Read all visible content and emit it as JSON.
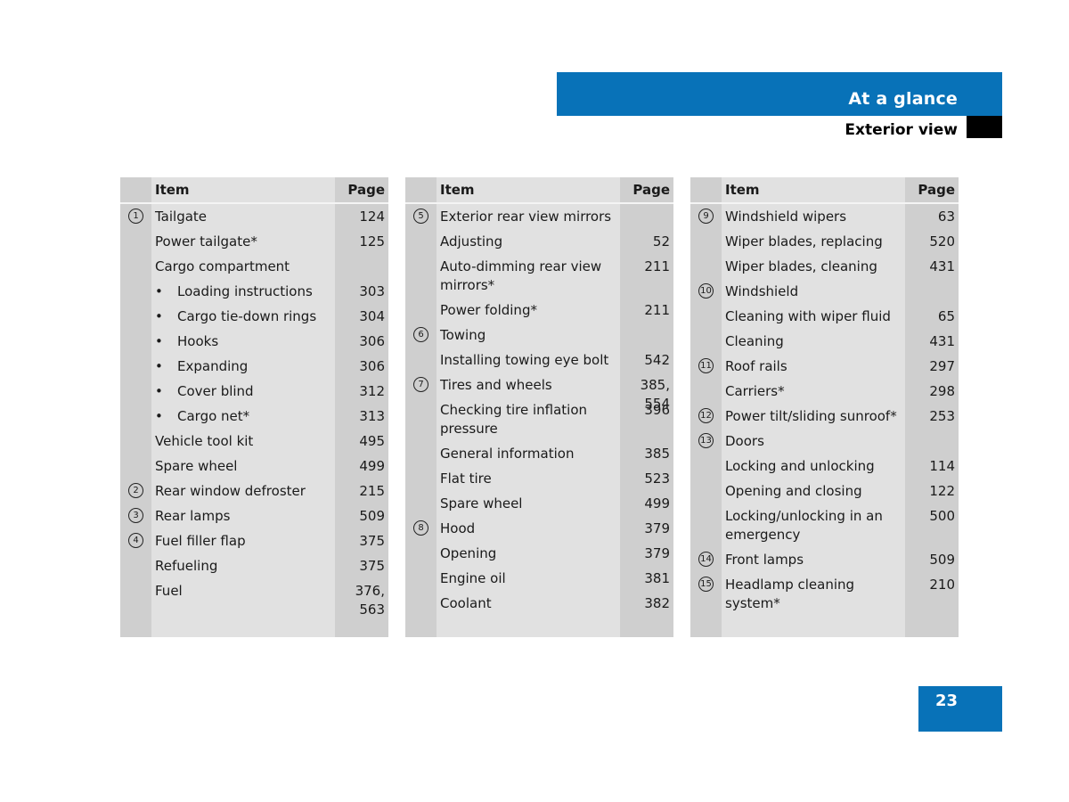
{
  "header": {
    "section_title": "At a glance",
    "subsection_title": "Exterior view",
    "accent_color": "#0872b8"
  },
  "page_number": "23",
  "tables": [
    {
      "header": {
        "item": "Item",
        "page": "Page"
      },
      "rows": [
        {
          "num": "1",
          "label": "Tailgate",
          "page": "124",
          "bullet": false
        },
        {
          "num": "",
          "label": "Power tailgate*",
          "page": "125",
          "bullet": false
        },
        {
          "num": "",
          "label": "Cargo compartment",
          "page": "",
          "bullet": false
        },
        {
          "num": "",
          "label": "Loading instructions",
          "page": "303",
          "bullet": true
        },
        {
          "num": "",
          "label": "Cargo tie-down rings",
          "page": "304",
          "bullet": true
        },
        {
          "num": "",
          "label": "Hooks",
          "page": "306",
          "bullet": true
        },
        {
          "num": "",
          "label": "Expanding",
          "page": "306",
          "bullet": true
        },
        {
          "num": "",
          "label": "Cover blind",
          "page": "312",
          "bullet": true
        },
        {
          "num": "",
          "label": "Cargo net*",
          "page": "313",
          "bullet": true
        },
        {
          "num": "",
          "label": "Vehicle tool kit",
          "page": "495",
          "bullet": false
        },
        {
          "num": "",
          "label": "Spare wheel",
          "page": "499",
          "bullet": false
        },
        {
          "num": "2",
          "label": "Rear window defroster",
          "page": "215",
          "bullet": false
        },
        {
          "num": "3",
          "label": "Rear lamps",
          "page": "509",
          "bullet": false
        },
        {
          "num": "4",
          "label": "Fuel filler flap",
          "page": "375",
          "bullet": false
        },
        {
          "num": "",
          "label": "Refueling",
          "page": "375",
          "bullet": false
        },
        {
          "num": "",
          "label": "Fuel",
          "page": "376, 563",
          "bullet": false
        }
      ]
    },
    {
      "header": {
        "item": "Item",
        "page": "Page"
      },
      "rows": [
        {
          "num": "5",
          "label": "Exterior rear view mirrors",
          "page": "",
          "bullet": false
        },
        {
          "num": "",
          "label": "Adjusting",
          "page": "52",
          "bullet": false
        },
        {
          "num": "",
          "label": "Auto-dimming rear view mirrors*",
          "page": "211",
          "bullet": false
        },
        {
          "num": "",
          "label": "Power folding*",
          "page": "211",
          "bullet": false
        },
        {
          "num": "6",
          "label": "Towing",
          "page": "",
          "bullet": false
        },
        {
          "num": "",
          "label": "Installing towing eye bolt",
          "page": "542",
          "bullet": false
        },
        {
          "num": "7",
          "label": "Tires and wheels",
          "page": "385, 554",
          "bullet": false
        },
        {
          "num": "",
          "label": "Checking tire inflation pressure",
          "page": "396",
          "bullet": false
        },
        {
          "num": "",
          "label": "General information",
          "page": "385",
          "bullet": false
        },
        {
          "num": "",
          "label": "Flat tire",
          "page": "523",
          "bullet": false
        },
        {
          "num": "",
          "label": "Spare wheel",
          "page": "499",
          "bullet": false
        },
        {
          "num": "8",
          "label": "Hood",
          "page": "379",
          "bullet": false
        },
        {
          "num": "",
          "label": "Opening",
          "page": "379",
          "bullet": false
        },
        {
          "num": "",
          "label": "Engine oil",
          "page": "381",
          "bullet": false
        },
        {
          "num": "",
          "label": "Coolant",
          "page": "382",
          "bullet": false
        }
      ]
    },
    {
      "header": {
        "item": "Item",
        "page": "Page"
      },
      "rows": [
        {
          "num": "9",
          "label": "Windshield wipers",
          "page": "63",
          "bullet": false
        },
        {
          "num": "",
          "label": "Wiper blades, replacing",
          "page": "520",
          "bullet": false
        },
        {
          "num": "",
          "label": "Wiper blades, cleaning",
          "page": "431",
          "bullet": false
        },
        {
          "num": "10",
          "label": "Windshield",
          "page": "",
          "bullet": false
        },
        {
          "num": "",
          "label": "Cleaning with wiper fluid",
          "page": "65",
          "bullet": false
        },
        {
          "num": "",
          "label": "Cleaning",
          "page": "431",
          "bullet": false
        },
        {
          "num": "11",
          "label": "Roof rails",
          "page": "297",
          "bullet": false
        },
        {
          "num": "",
          "label": "Carriers*",
          "page": "298",
          "bullet": false
        },
        {
          "num": "12",
          "label": "Power tilt/sliding sunroof*",
          "page": "253",
          "bullet": false
        },
        {
          "num": "13",
          "label": "Doors",
          "page": "",
          "bullet": false
        },
        {
          "num": "",
          "label": "Locking and unlocking",
          "page": "114",
          "bullet": false
        },
        {
          "num": "",
          "label": "Opening and closing",
          "page": "122",
          "bullet": false
        },
        {
          "num": "",
          "label": "Locking/unlocking in an emergency",
          "page": "500",
          "bullet": false
        },
        {
          "num": "14",
          "label": "Front lamps",
          "page": "509",
          "bullet": false
        },
        {
          "num": "15",
          "label": "Headlamp cleaning system*",
          "page": "210",
          "bullet": false
        }
      ]
    }
  ]
}
